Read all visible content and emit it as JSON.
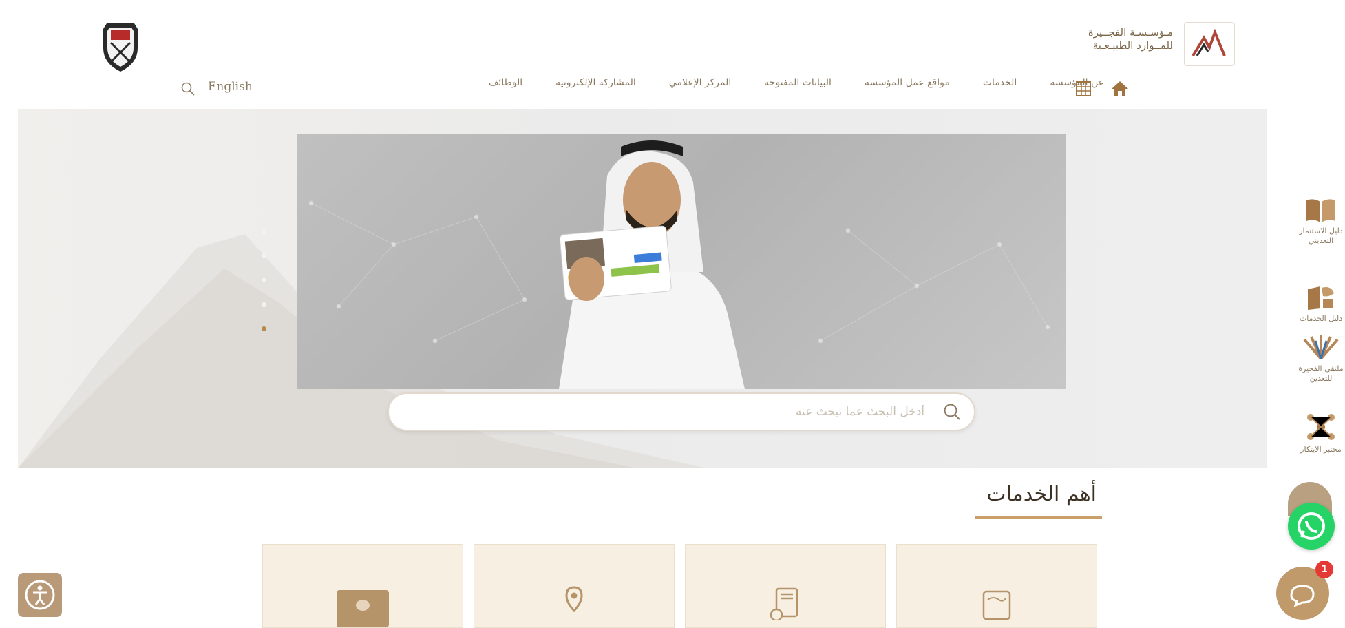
{
  "header": {
    "org_name_line1": "مـؤسـسـة الفجــيرة",
    "org_name_line2": "للمــوارد الطبيـعـية",
    "language_link": "English"
  },
  "nav": {
    "items": [
      "عن المؤسسة",
      "الخدمات",
      "مواقع عمل المؤسسة",
      "البيانات المفتوحة",
      "المركز الإعلامي",
      "المشاركة الإلكترونية",
      "الوظائف"
    ]
  },
  "search": {
    "placeholder": "أدخل البحث عما تبحث عنه"
  },
  "section": {
    "title": "أهم الخدمات"
  },
  "rail": {
    "items": [
      {
        "label": "دليل الاستثمار التعديني"
      },
      {
        "label": "دليل الخدمات"
      },
      {
        "label": "ملتقى الفجيرة للتعدين"
      },
      {
        "label": "مختبر الابتكار"
      }
    ]
  },
  "chat": {
    "badge_count": "1"
  },
  "colors": {
    "accent": "#c09a6b",
    "whatsapp": "#25d366",
    "badge": "#e53935"
  },
  "slider": {
    "slide_count": 5,
    "active_slide": 5
  }
}
